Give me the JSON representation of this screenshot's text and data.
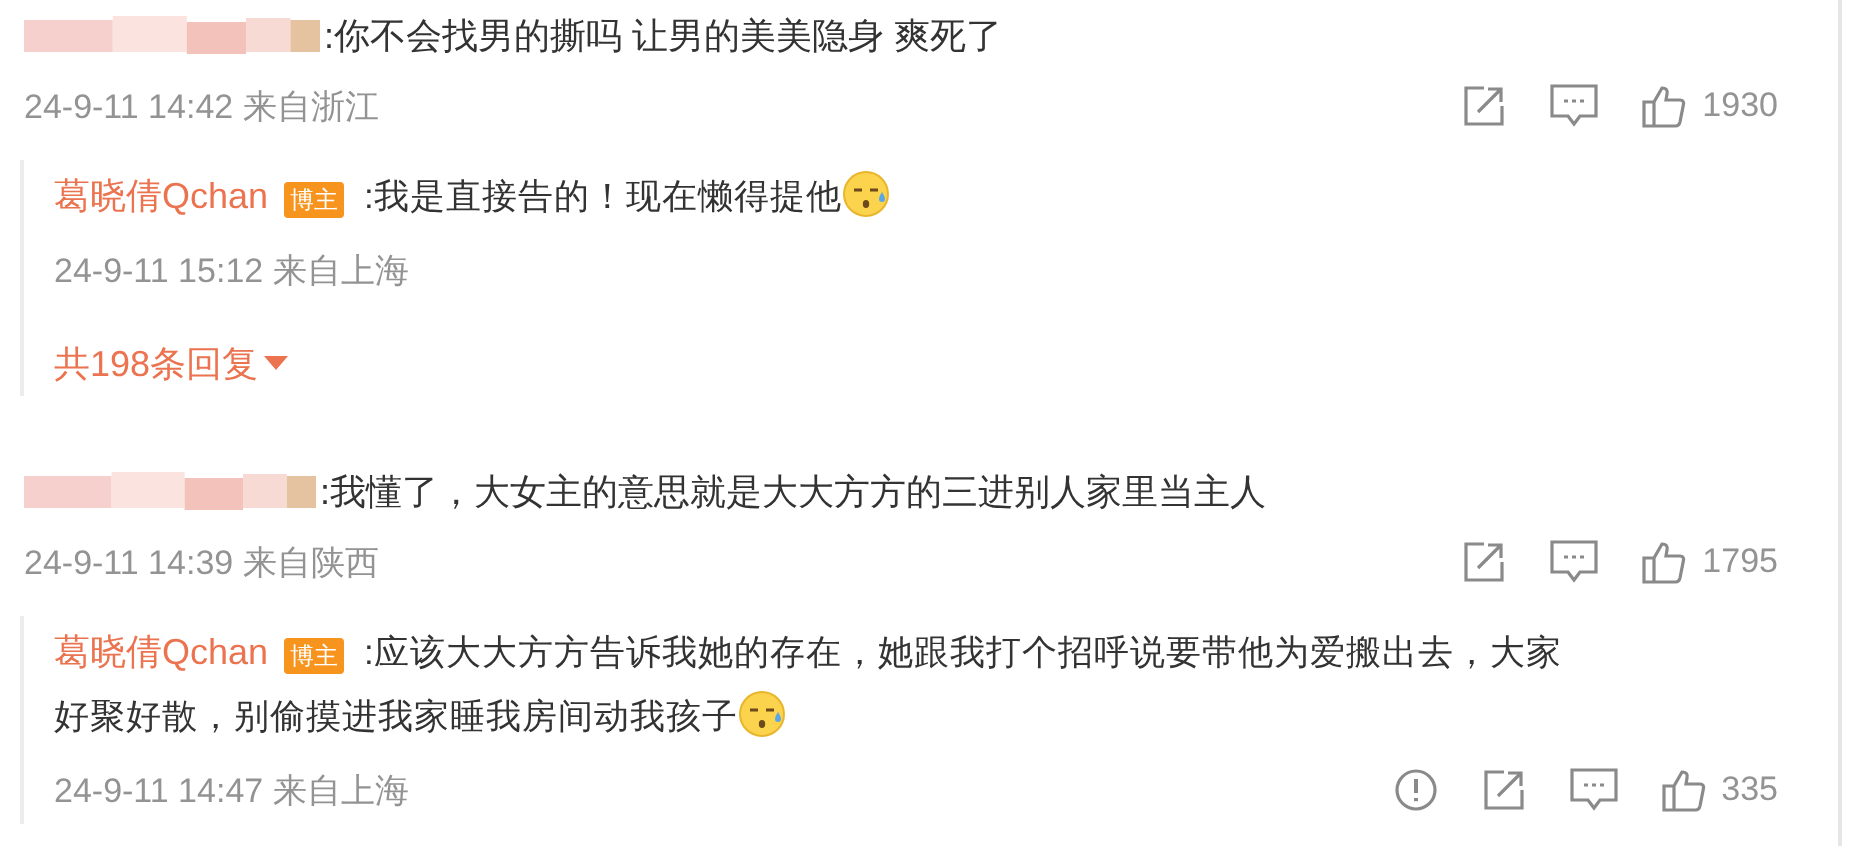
{
  "comments": [
    {
      "text": ":你不会找男的撕吗 让男的美美隐身 爽死了",
      "meta": "24-9-11 14:42 来自浙江",
      "actions": [
        {
          "kind": "share"
        },
        {
          "kind": "comment"
        },
        {
          "kind": "like",
          "count": "1930"
        }
      ],
      "replies": [
        {
          "author": "葛晓倩Qchan",
          "badge": "博主",
          "lines": [
            ":我是直接告的！现在懒得提他"
          ],
          "meta": "24-9-11 15:12 来自上海"
        }
      ],
      "more_replies": "共198条回复"
    },
    {
      "text": ":我懂了，大女主的意思就是大大方方的三进别人家里当主人",
      "meta": "24-9-11 14:39 来自陕西",
      "actions": [
        {
          "kind": "share"
        },
        {
          "kind": "comment"
        },
        {
          "kind": "like",
          "count": "1795"
        }
      ],
      "replies": [
        {
          "author": "葛晓倩Qchan",
          "badge": "博主",
          "lines": [
            ":应该大大方方告诉我她的存在，她跟我打个招呼说要带他为爱搬出去，大家",
            "好聚好散，别偷摸进我家睡我房间动我孩子"
          ],
          "meta": "24-9-11 14:47 来自上海",
          "actions": [
            {
              "kind": "report"
            },
            {
              "kind": "share"
            },
            {
              "kind": "comment"
            },
            {
              "kind": "like",
              "count": "335"
            }
          ]
        }
      ]
    }
  ]
}
